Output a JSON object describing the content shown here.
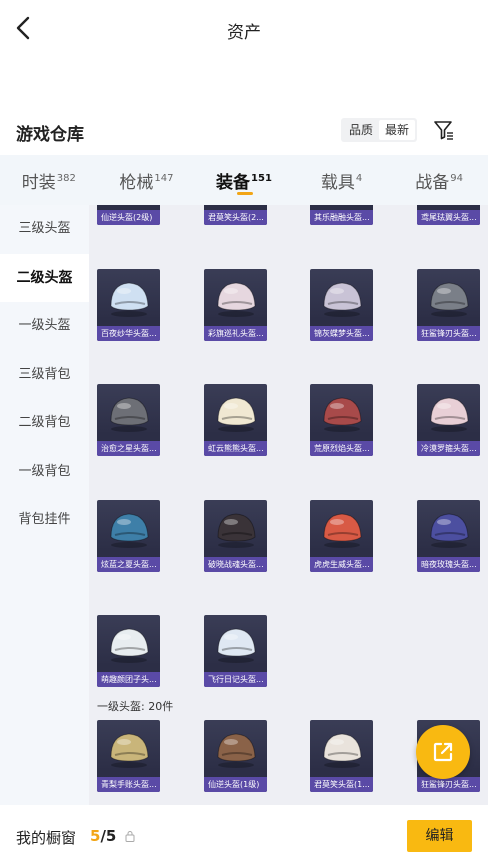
{
  "header": {
    "title": "资产"
  },
  "section": {
    "title": "游戏仓库",
    "sort_options": [
      "品质",
      "最新"
    ]
  },
  "tabs": [
    {
      "label": "时装",
      "count": "382"
    },
    {
      "label": "枪械",
      "count": "147"
    },
    {
      "label": "装备",
      "count": "151"
    },
    {
      "label": "载具",
      "count": "4"
    },
    {
      "label": "战备",
      "count": "94"
    }
  ],
  "sidebar": {
    "items": [
      {
        "label": "三级头盔"
      },
      {
        "label": "二级头盔"
      },
      {
        "label": "一级头盔"
      },
      {
        "label": "三级背包"
      },
      {
        "label": "二级背包"
      },
      {
        "label": "一级背包"
      },
      {
        "label": "背包挂件"
      }
    ]
  },
  "grid": {
    "top_partial": [
      "仙逆头盔(2级)",
      "君莫笑头盔(2...",
      "其乐融融头盔...",
      "鸢尾珐翼头盔..."
    ],
    "level2": [
      {
        "name": "百夜纱华头盔...",
        "color": "#cfe0f2"
      },
      {
        "name": "彩旗巡礼头盔...",
        "color": "#e6d7df"
      },
      {
        "name": "锦灰蝶梦头盔...",
        "color": "#c9c3d6"
      },
      {
        "name": "狂鲨锋刃头盔...",
        "color": "#7a7f88"
      },
      {
        "name": "治愈之星头盔...",
        "color": "#6d6f76"
      },
      {
        "name": "虹云熊熊头盔...",
        "color": "#f0e8d2"
      },
      {
        "name": "荒原烈焰头盔...",
        "color": "#a84a4a"
      },
      {
        "name": "冷漠罗箍头盔...",
        "color": "#e8cfd6"
      },
      {
        "name": "炫蓝之夏头盔...",
        "color": "#3e7fa8"
      },
      {
        "name": "破晓战魂头盔...",
        "color": "#3a3338"
      },
      {
        "name": "虎虎生威头盔...",
        "color": "#d85a45"
      },
      {
        "name": "暗夜玫瑰头盔...",
        "color": "#4c4fa0"
      },
      {
        "name": "萌趣颜团子头...",
        "color": "#e8edf0"
      },
      {
        "name": "飞行日记头盔...",
        "color": "#dfe8f3"
      }
    ],
    "level1_label": "一级头盔: 20件",
    "level1": [
      {
        "name": "青梨手账头盔...",
        "color": "#c9b57a"
      },
      {
        "name": "仙逆头盔(1级)",
        "color": "#8a6248"
      },
      {
        "name": "君莫笑头盔(1...",
        "color": "#e9e3dc"
      },
      {
        "name": "狂鲨锋刃头盔...",
        "color": "#7a7f88"
      }
    ]
  },
  "bottom": {
    "label": "我的橱窗",
    "count_current": "5",
    "count_total": "/5",
    "edit_label": "编辑"
  }
}
